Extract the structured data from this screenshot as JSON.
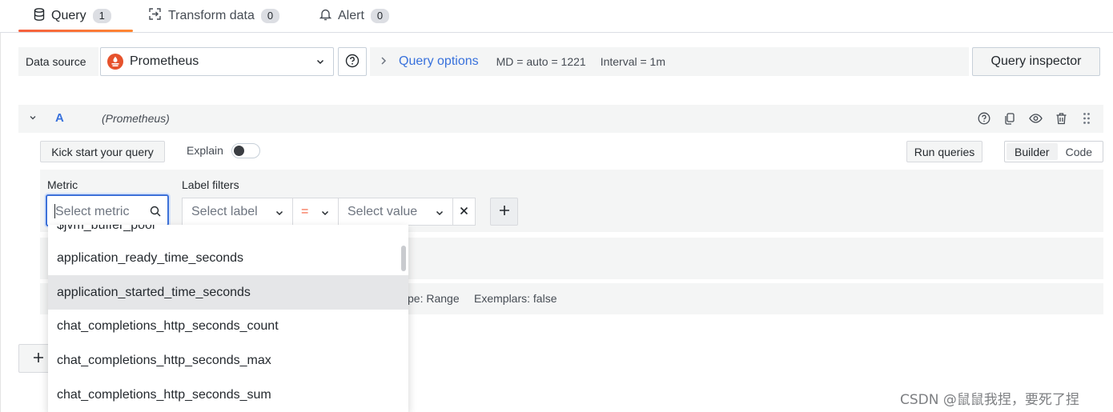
{
  "tabs": [
    {
      "label": "Query",
      "count": "1",
      "icon": "database-icon"
    },
    {
      "label": "Transform data",
      "count": "0",
      "icon": "transform-icon"
    },
    {
      "label": "Alert",
      "count": "0",
      "icon": "bell-icon"
    }
  ],
  "datasource": {
    "label": "Data source",
    "selected": "Prometheus",
    "query_options_label": "Query options",
    "md": "MD = auto = 1221",
    "interval": "Interval = 1m",
    "inspector_label": "Query inspector"
  },
  "query": {
    "letter": "A",
    "datasource_name": "(Prometheus)",
    "kick_start_label": "Kick start your query",
    "explain_label": "Explain",
    "run_label": "Run queries",
    "modes": [
      "Builder",
      "Code"
    ],
    "active_mode": "Builder",
    "metric_label": "Metric",
    "metric_placeholder": "Select metric",
    "label_filters_label": "Label filters",
    "select_label_placeholder": "Select label",
    "operator": "=",
    "select_value_placeholder": "Select value",
    "options_type": "pe: Range",
    "options_exemplars": "Exemplars: false"
  },
  "dropdown": {
    "items": [
      "$jvm_buffer_pool",
      "application_ready_time_seconds",
      "application_started_time_seconds",
      "chat_completions_http_seconds_count",
      "chat_completions_http_seconds_max",
      "chat_completions_http_seconds_sum"
    ],
    "hover_index": 2
  },
  "watermark": "CSDN @鼠鼠我捏，要死了捏",
  "colors": {
    "accent": "#3871dc",
    "tab_underline": "#f55f3e",
    "prometheus": "#e6522c"
  }
}
